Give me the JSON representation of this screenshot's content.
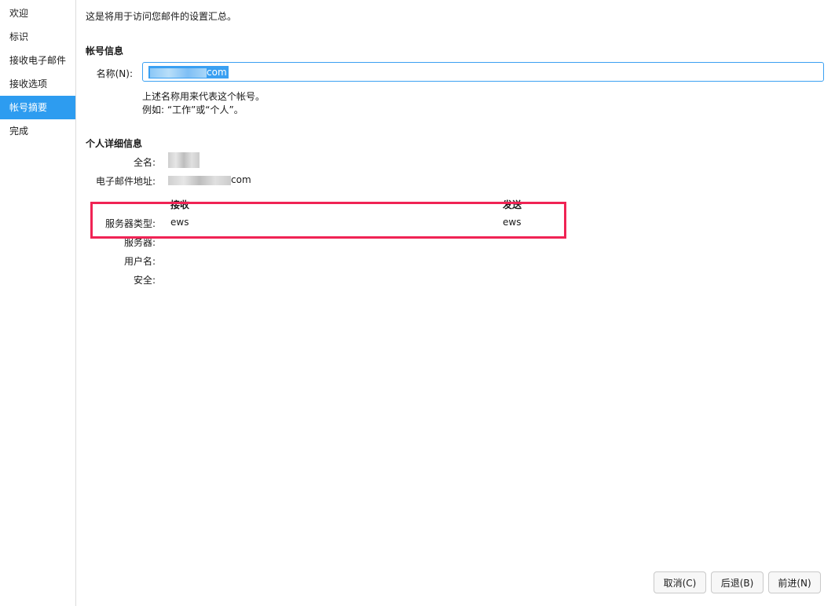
{
  "sidebar": {
    "items": [
      {
        "label": "欢迎"
      },
      {
        "label": "标识"
      },
      {
        "label": "接收电子邮件"
      },
      {
        "label": "接收选项"
      },
      {
        "label": "帐号摘要"
      },
      {
        "label": "完成"
      }
    ],
    "active_index": 4
  },
  "main": {
    "intro": "这是将用于访问您邮件的设置汇总。",
    "account_info": {
      "heading": "帐号信息",
      "name_label": "名称(N):",
      "name_value": "com",
      "hint_line1": "上述名称用来代表这个帐号。",
      "hint_line2": "例如: “工作”或“个人”。"
    },
    "personal": {
      "heading": "个人详细信息",
      "fullname_label": "全名:",
      "email_label": "电子邮件地址:",
      "email_suffix": "com"
    },
    "server": {
      "receive_header": "接收",
      "send_header": "发送",
      "type_label": "服务器类型:",
      "receive_type": "ews",
      "send_type": "ews",
      "server_label": "服务器:",
      "username_label": "用户名:",
      "security_label": "安全:"
    }
  },
  "buttons": {
    "cancel": "取消(C)",
    "back": "后退(B)",
    "forward": "前进(N)"
  },
  "colors": {
    "accent": "#2d9cf0",
    "highlight_box": "#f02354"
  }
}
